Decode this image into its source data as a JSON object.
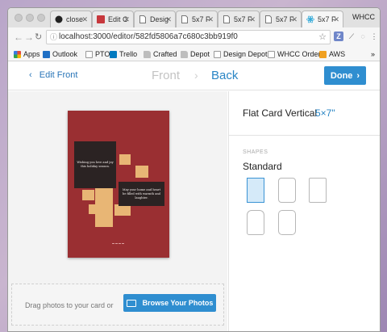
{
  "browser": {
    "tabs": [
      {
        "label": "close",
        "icon": "github-icon",
        "active": false
      },
      {
        "label": "Edit C",
        "icon": "card-app-icon",
        "active": false
      },
      {
        "label": "Desig",
        "icon": "doc-icon",
        "active": false
      },
      {
        "label": "5x7 F",
        "icon": "doc-icon",
        "active": false
      },
      {
        "label": "5x7 F",
        "icon": "doc-icon",
        "active": false
      },
      {
        "label": "5x7 F",
        "icon": "doc-icon",
        "active": false
      },
      {
        "label": "5x7 F",
        "icon": "react-icon",
        "active": true
      }
    ],
    "profile": "WHCC",
    "url": "localhost:3000/editor/582fd5806a7c680c3bb919f0",
    "bookmarks": [
      {
        "label": "Apps",
        "icon": "apps-icon",
        "color": "#e24b3b"
      },
      {
        "label": "Outlook",
        "icon": "outlook-icon",
        "color": "#1f6fc4"
      },
      {
        "label": "PTO",
        "icon": "doc-icon",
        "color": "#9e9e9e"
      },
      {
        "label": "Trello",
        "icon": "trello-icon",
        "color": "#0079bf"
      },
      {
        "label": "Crafted",
        "icon": "folder-icon",
        "color": "#9e9e9e"
      },
      {
        "label": "Depot",
        "icon": "folder-icon",
        "color": "#9e9e9e"
      },
      {
        "label": "Design Depot",
        "icon": "doc-icon",
        "color": "#9e9e9e"
      },
      {
        "label": "WHCC Order",
        "icon": "doc-icon",
        "color": "#9e9e9e"
      },
      {
        "label": "AWS",
        "icon": "aws-icon",
        "color": "#f0a020"
      }
    ],
    "more": "»"
  },
  "header": {
    "edit_front": "Edit Front",
    "step_front": "Front",
    "step_back": "Back",
    "done": "Done"
  },
  "card": {
    "quote_1": "Wishing you love and joy this holiday season.",
    "quote_2": "May your home and heart be filled with warmth and laughter."
  },
  "dropzone": {
    "text": "Drag photos to your card or",
    "browse": "Browse Your Photos"
  },
  "sidebar": {
    "title": "Flat Card Vertical",
    "size": "5×7\"",
    "shapes_label": "SHAPES",
    "shape_value": "Standard"
  },
  "colors": {
    "accent": "#2f8ed0",
    "card_background": "#9a2f32",
    "photo_placeholder": "#e8b675"
  }
}
